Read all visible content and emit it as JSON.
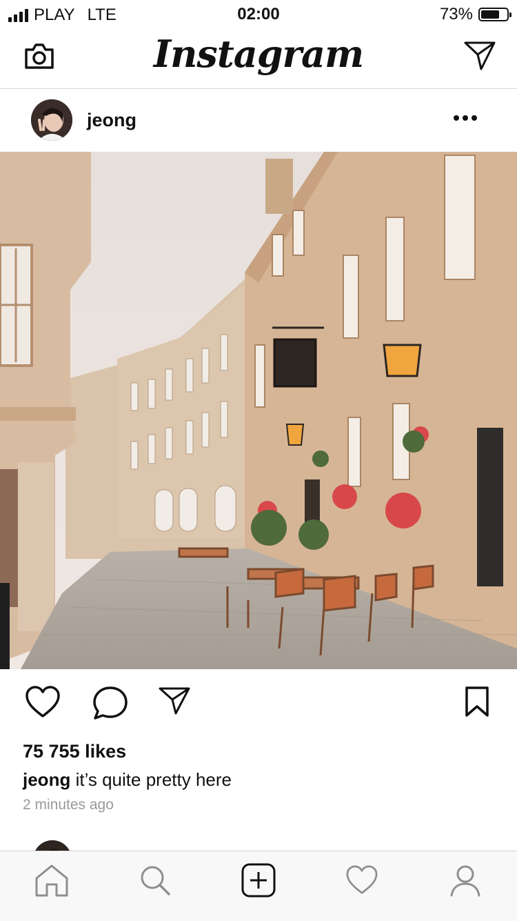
{
  "status_bar": {
    "carrier": "PLAY",
    "network": "LTE",
    "time": "02:00",
    "battery_percent": "73%",
    "battery_level": 0.73
  },
  "nav": {
    "logo": "Instagram",
    "left_icon": "camera-icon",
    "right_icon": "direct-message-icon"
  },
  "post": {
    "username": "jeong",
    "likes": "75 755 likes",
    "caption_user": "jeong",
    "caption_text": " it’s quite pretty here",
    "time_ago": "2 minutes ago",
    "photo_icon": "street-photo",
    "actions": [
      "heart-icon",
      "comment-icon",
      "share-icon",
      "bookmark-icon"
    ]
  },
  "tab_bar": {
    "items": [
      "home-icon",
      "search-icon",
      "add-post-icon",
      "activity-icon",
      "profile-icon"
    ]
  },
  "colors": {
    "text": "#111111",
    "muted": "#999999",
    "tab_icon": "#8e8e8e",
    "divider": "#d8d8d8"
  }
}
